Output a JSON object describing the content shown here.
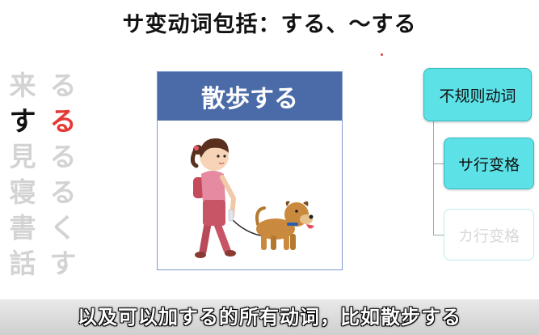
{
  "title": "サ变动词包括：する、〜する",
  "left_columns": {
    "kanji": [
      "来",
      "す",
      "見",
      "寝",
      "書",
      "話"
    ],
    "kana": [
      "る",
      "る",
      "る",
      "る",
      "く",
      "す"
    ]
  },
  "card": {
    "header": "散歩する",
    "illustration": "girl-walking-dog"
  },
  "tree": {
    "root": "不规则动词",
    "child_sa": "サ行变格",
    "child_ka": "カ行变格"
  },
  "subtitle": "以及可以加する的所有动词，比如散步する",
  "colors": {
    "header_blue": "#4a6ba8",
    "cyan_box": "#5ce1e6",
    "highlight_red": "#e53935"
  }
}
